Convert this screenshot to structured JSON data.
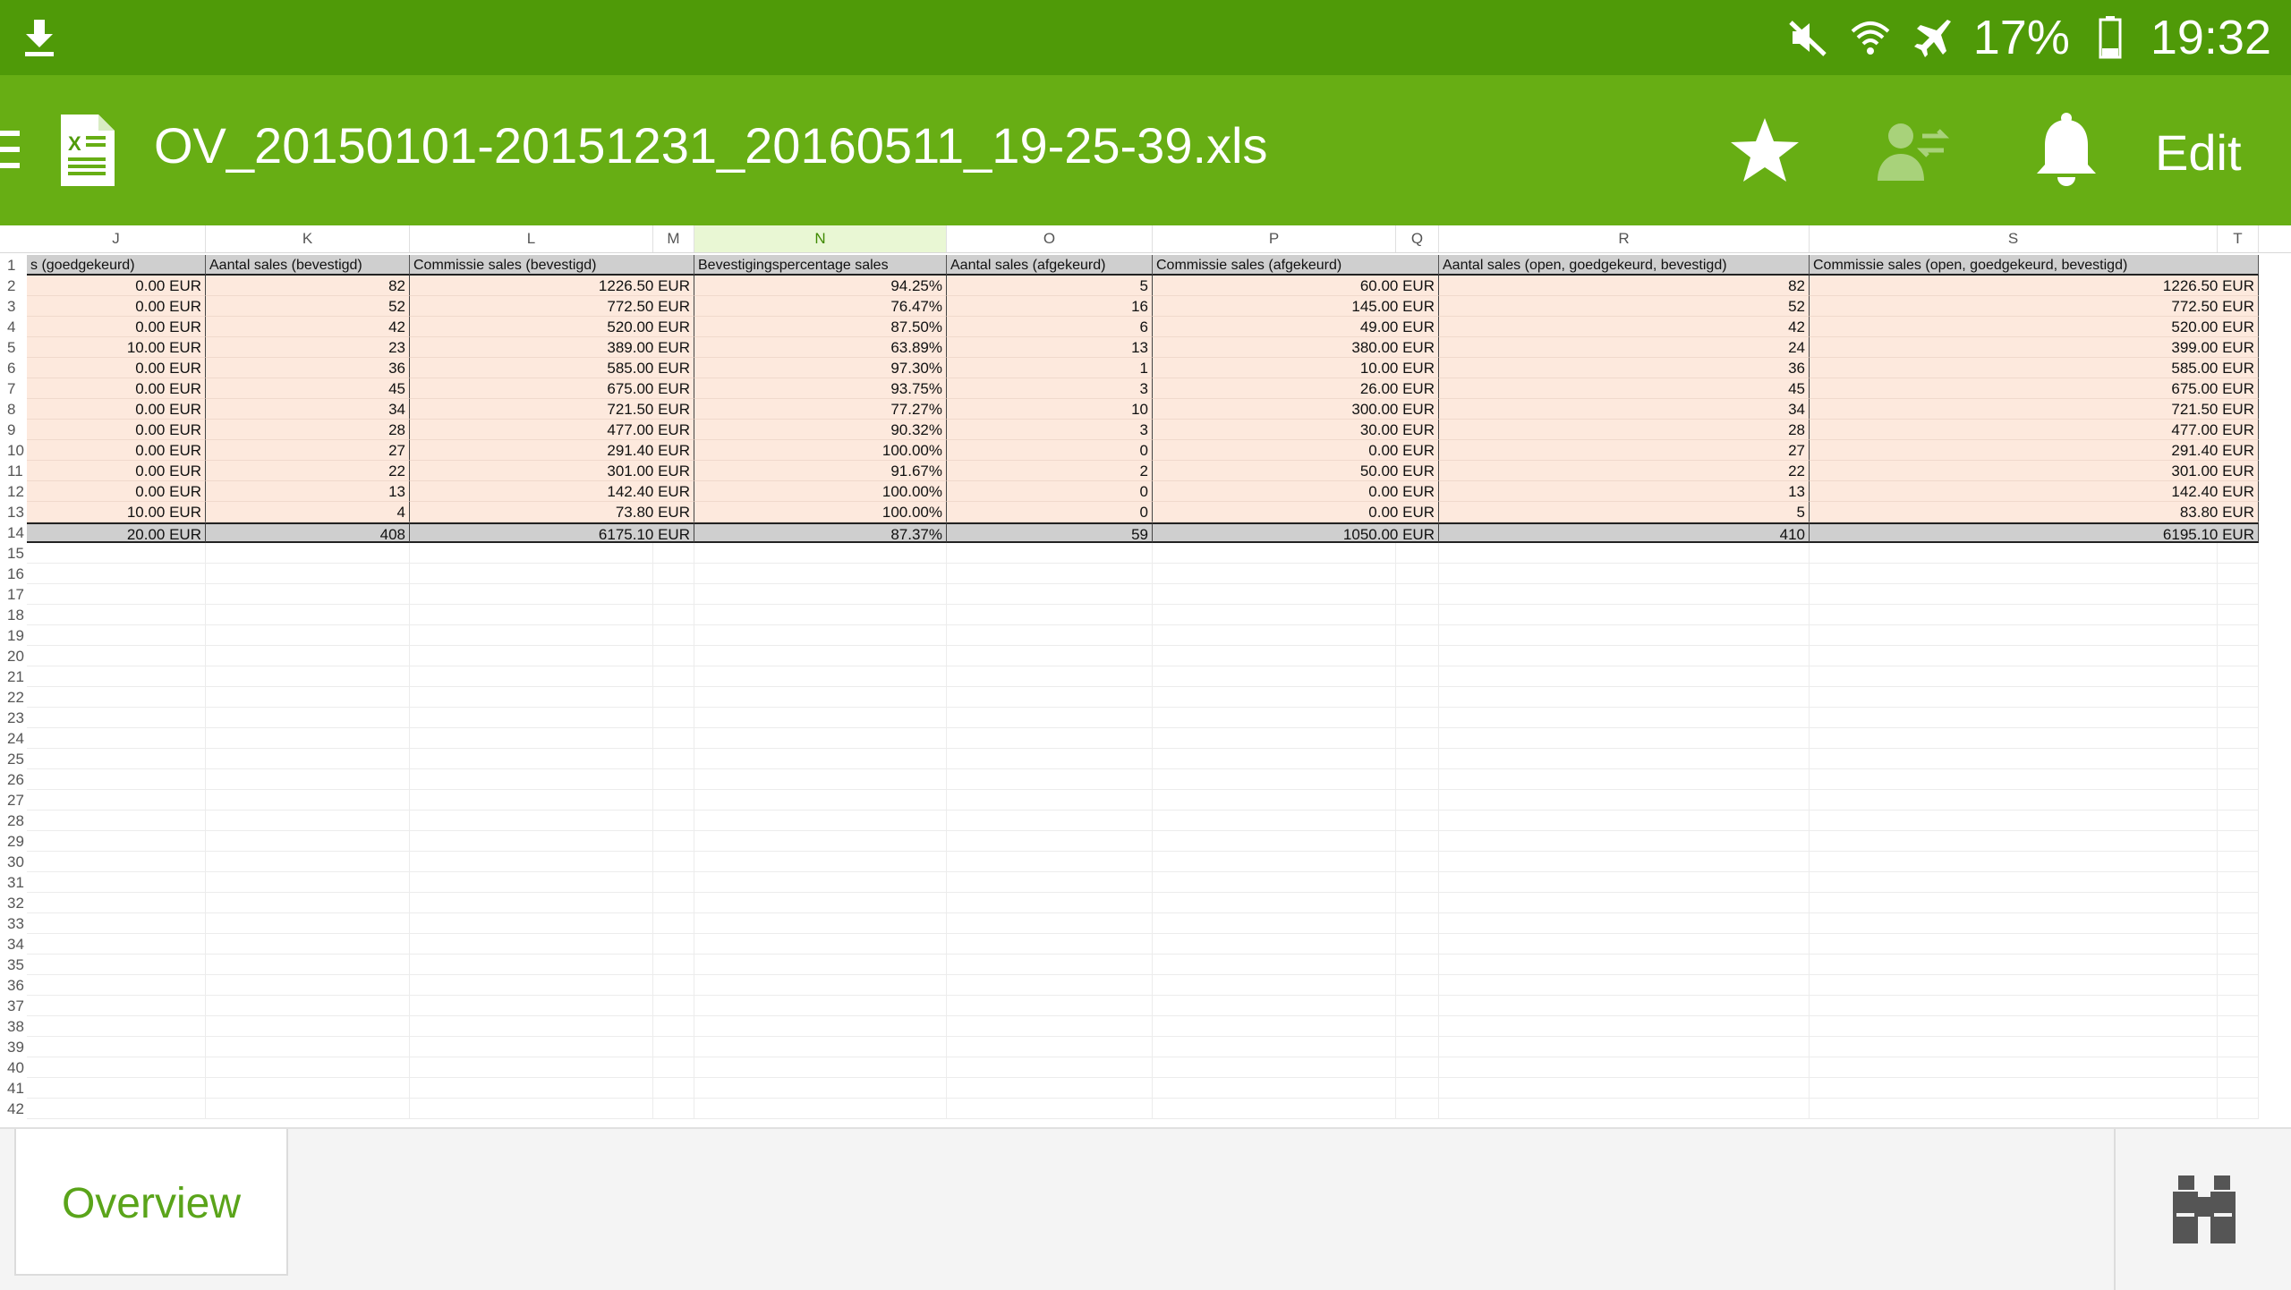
{
  "status_bar": {
    "icons": [
      "download-icon",
      "mute-icon",
      "wifi-icon",
      "airplane-icon",
      "battery-icon"
    ],
    "battery": "17%",
    "time": "19:32"
  },
  "app_bar": {
    "icons": [
      "menu-icon",
      "excel-file-icon",
      "star-icon",
      "share-user-icon",
      "bell-icon"
    ],
    "title": "OV_20150101-20151231_20160511_19-25-39.xls",
    "edit_label": "Edit",
    "colors": {
      "status": "#4f9a08",
      "bar": "#67ae14",
      "accent": "#5aa41a"
    }
  },
  "sheet": {
    "columns": [
      "J",
      "K",
      "L",
      "M",
      "N",
      "O",
      "P",
      "Q",
      "R",
      "S",
      "T"
    ],
    "selected_column": "N",
    "header_row": {
      "num": "1",
      "cells": [
        "s (goedgekeurd)",
        "Aantal sales (bevestigd)",
        "Commissie sales (bevestigd)",
        "Bevestigingspercentage sales",
        "Aantal sales (afgekeurd)",
        "Commissie sales (afgekeurd)",
        "Aantal sales (open, goedgekeurd, bevestigd)",
        "Commissie sales (open, goedgekeurd, bevestigd)"
      ]
    },
    "data_rows": [
      {
        "num": "2",
        "cells": [
          "0.00 EUR",
          "82",
          "1226.50 EUR",
          "94.25%",
          "5",
          "60.00 EUR",
          "82",
          "1226.50 EUR"
        ]
      },
      {
        "num": "3",
        "cells": [
          "0.00 EUR",
          "52",
          "772.50 EUR",
          "76.47%",
          "16",
          "145.00 EUR",
          "52",
          "772.50 EUR"
        ]
      },
      {
        "num": "4",
        "cells": [
          "0.00 EUR",
          "42",
          "520.00 EUR",
          "87.50%",
          "6",
          "49.00 EUR",
          "42",
          "520.00 EUR"
        ]
      },
      {
        "num": "5",
        "cells": [
          "10.00 EUR",
          "23",
          "389.00 EUR",
          "63.89%",
          "13",
          "380.00 EUR",
          "24",
          "399.00 EUR"
        ]
      },
      {
        "num": "6",
        "cells": [
          "0.00 EUR",
          "36",
          "585.00 EUR",
          "97.30%",
          "1",
          "10.00 EUR",
          "36",
          "585.00 EUR"
        ]
      },
      {
        "num": "7",
        "cells": [
          "0.00 EUR",
          "45",
          "675.00 EUR",
          "93.75%",
          "3",
          "26.00 EUR",
          "45",
          "675.00 EUR"
        ]
      },
      {
        "num": "8",
        "cells": [
          "0.00 EUR",
          "34",
          "721.50 EUR",
          "77.27%",
          "10",
          "300.00 EUR",
          "34",
          "721.50 EUR"
        ]
      },
      {
        "num": "9",
        "cells": [
          "0.00 EUR",
          "28",
          "477.00 EUR",
          "90.32%",
          "3",
          "30.00 EUR",
          "28",
          "477.00 EUR"
        ]
      },
      {
        "num": "10",
        "cells": [
          "0.00 EUR",
          "27",
          "291.40 EUR",
          "100.00%",
          "0",
          "0.00 EUR",
          "27",
          "291.40 EUR"
        ]
      },
      {
        "num": "11",
        "cells": [
          "0.00 EUR",
          "22",
          "301.00 EUR",
          "91.67%",
          "2",
          "50.00 EUR",
          "22",
          "301.00 EUR"
        ]
      },
      {
        "num": "12",
        "cells": [
          "0.00 EUR",
          "13",
          "142.40 EUR",
          "100.00%",
          "0",
          "0.00 EUR",
          "13",
          "142.40 EUR"
        ]
      },
      {
        "num": "13",
        "cells": [
          "10.00 EUR",
          "4",
          "73.80 EUR",
          "100.00%",
          "0",
          "0.00 EUR",
          "5",
          "83.80 EUR"
        ]
      }
    ],
    "total_row": {
      "num": "14",
      "cells": [
        "20.00  EUR",
        "408",
        "6175.10  EUR",
        "87.37%",
        "59",
        "1050.00  EUR",
        "410",
        "6195.10  EUR"
      ]
    },
    "empty_rows": [
      "15",
      "16",
      "17",
      "18",
      "19",
      "20",
      "21",
      "22",
      "23",
      "24",
      "25",
      "26",
      "27",
      "28",
      "29",
      "30",
      "31",
      "32",
      "33",
      "34",
      "35",
      "36",
      "37",
      "38",
      "39",
      "40",
      "41",
      "42"
    ]
  },
  "bottom_bar": {
    "tab_label": "Overview",
    "icons": [
      "binoculars-icon"
    ]
  }
}
